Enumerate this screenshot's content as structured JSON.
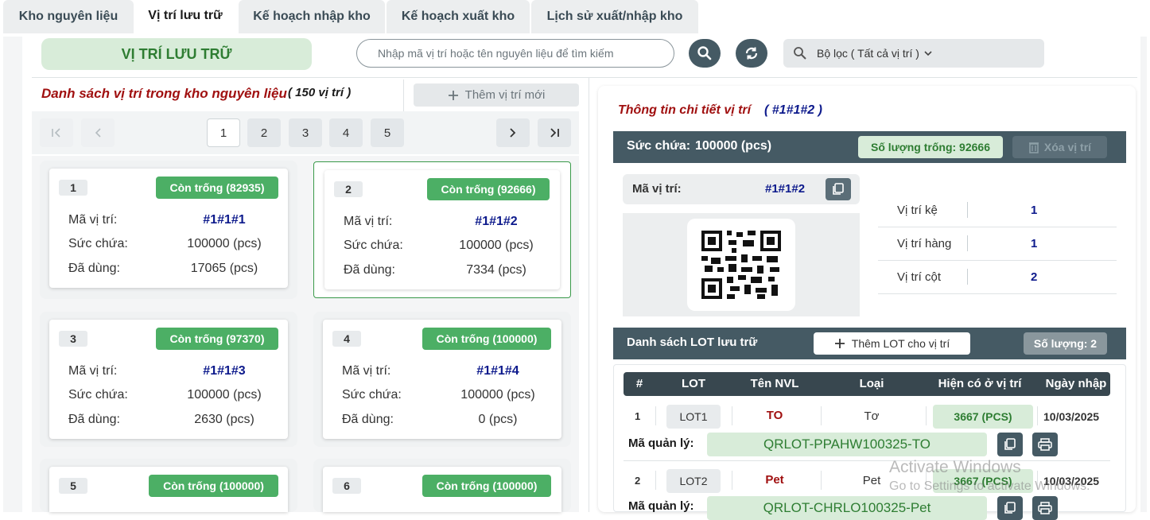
{
  "tabs": [
    {
      "label": "Kho nguyên liệu",
      "active": false
    },
    {
      "label": "Vị trí lưu trữ",
      "active": true
    },
    {
      "label": "Kế hoạch nhập kho",
      "active": false
    },
    {
      "label": "Kế hoạch xuất kho",
      "active": false
    },
    {
      "label": "Lịch sử xuất/nhập kho",
      "active": false
    }
  ],
  "header": {
    "title": "VỊ TRÍ LƯU TRỮ",
    "search_placeholder": "Nhập mã vị trí hoặc tên nguyên liệu để tìm kiếm",
    "filter_label": "Bộ lọc ( Tất cả vị trí )"
  },
  "list": {
    "title": "Danh sách vị trí trong kho nguyên liệu",
    "count": "( 150 vị trí )",
    "add_button": "Thêm vị trí mới",
    "pages": [
      "1",
      "2",
      "3",
      "4",
      "5"
    ],
    "current_page": "1",
    "field_code": "Mã vị trí:",
    "field_capacity": "Sức chứa:",
    "field_used": "Đã dùng:",
    "cards": [
      {
        "num": "1",
        "badge": "Còn trống (82935)",
        "code": "#1#1#1",
        "capacity": "100000 (pcs)",
        "used": "17065 (pcs)"
      },
      {
        "num": "2",
        "badge": "Còn trống (92666)",
        "code": "#1#1#2",
        "capacity": "100000 (pcs)",
        "used": "7334 (pcs)"
      },
      {
        "num": "3",
        "badge": "Còn trống (97370)",
        "code": "#1#1#3",
        "capacity": "100000 (pcs)",
        "used": "2630 (pcs)"
      },
      {
        "num": "4",
        "badge": "Còn trống (100000)",
        "code": "#1#1#4",
        "capacity": "100000 (pcs)",
        "used": "0 (pcs)"
      },
      {
        "num": "5",
        "badge": "Còn trống (100000)"
      },
      {
        "num": "6",
        "badge": "Còn trống (100000)"
      }
    ]
  },
  "detail": {
    "title": "Thông tin chi tiết vị trí",
    "code_title": "( #1#1#2 )",
    "capacity_label": "Sức chứa:",
    "capacity_value": "100000 (pcs)",
    "empty_badge": "Số lượng trống: 92666",
    "delete_button": "Xóa vị trí",
    "code_label": "Mã vị trí:",
    "code_value": "#1#1#2",
    "positions": [
      {
        "label": "Vị trí kệ",
        "value": "1"
      },
      {
        "label": "Vị trí hàng",
        "value": "1"
      },
      {
        "label": "Vị trí cột",
        "value": "2"
      }
    ],
    "lot_section_title": "Danh sách LOT lưu trữ",
    "add_lot_button": "Thêm LOT cho vị trí",
    "lot_count": "Số lượng: 2",
    "columns": [
      "#",
      "LOT",
      "Tên NVL",
      "Loại",
      "Hiện có ở vị trí",
      "Ngày nhập"
    ],
    "manager_label": "Mã quản lý:",
    "lots": [
      {
        "num": "1",
        "lot": "LOT1",
        "name": "TO",
        "type": "Tơ",
        "qty": "3667 (PCS)",
        "date": "10/03/2025",
        "manager_code": "QRLOT-PPAHW100325-TO"
      },
      {
        "num": "2",
        "lot": "LOT2",
        "name": "Pet",
        "type": "Pet",
        "qty": "3667 (PCS)",
        "date": "10/03/2025",
        "manager_code": "QRLOT-CHRLO100325-Pet"
      }
    ]
  },
  "watermark": {
    "line1": "Activate Windows",
    "line2": "Go to Settings to activate Windows."
  },
  "colors": {
    "primary_dark": "#455a64",
    "accent_green": "#4caf65",
    "title_red": "#a01010",
    "code_blue": "#0d1a8c"
  }
}
